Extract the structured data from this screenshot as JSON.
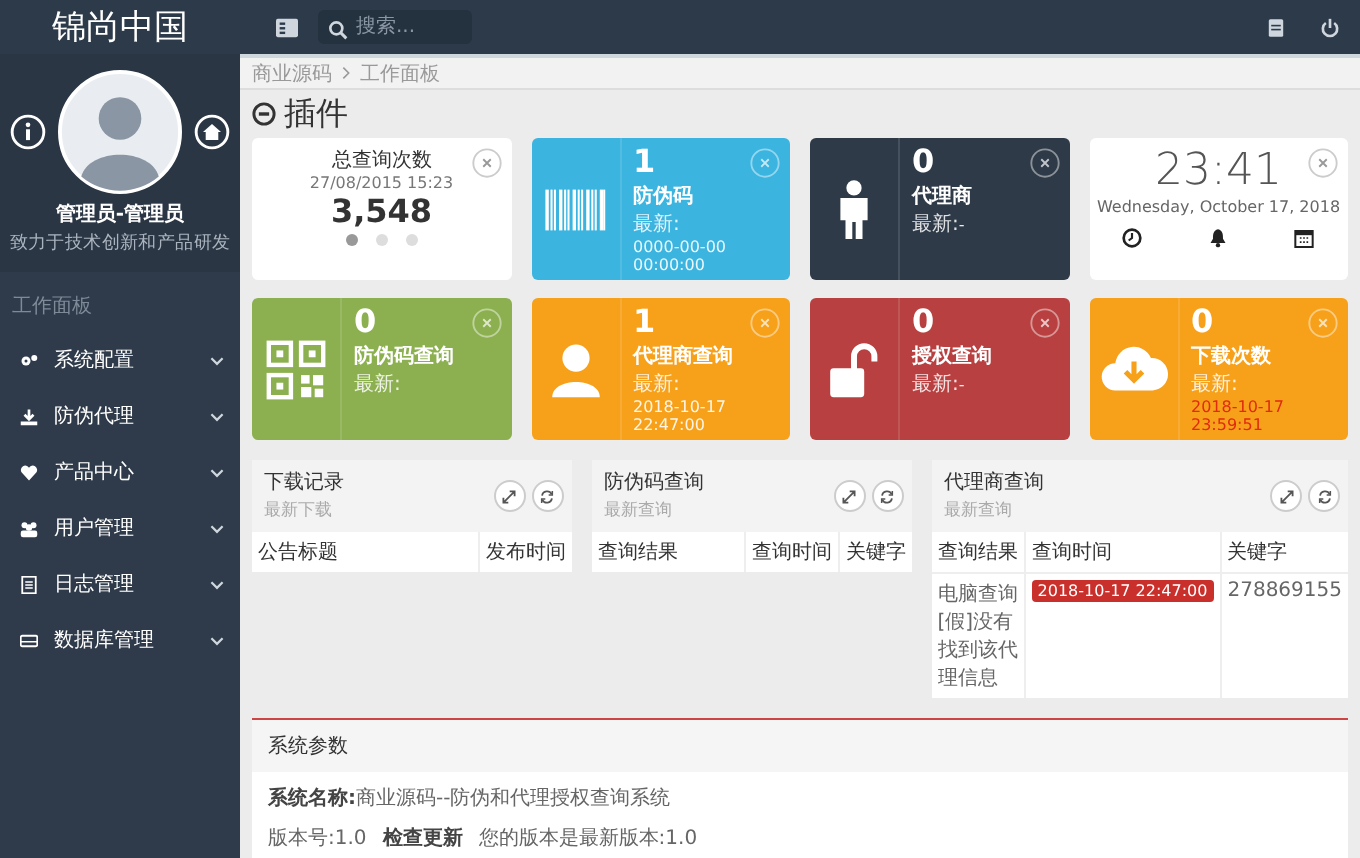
{
  "topbar": {
    "logo": "锦尚中国",
    "search": {
      "placeholder": "搜索..."
    }
  },
  "sidebar": {
    "user": {
      "name": "管理员-管理员",
      "motto": "致力于技术创新和产品研发"
    },
    "section": "工作面板",
    "items": [
      {
        "label": "系统配置",
        "expanded": false
      },
      {
        "label": "防伪代理",
        "expanded": false
      },
      {
        "label": "产品中心",
        "expanded": false
      },
      {
        "label": "用户管理",
        "expanded": false
      },
      {
        "label": "日志管理",
        "expanded": false
      },
      {
        "label": "数据库管理",
        "expanded": false
      }
    ]
  },
  "breadcrumb": [
    "商业源码",
    "工作面板"
  ],
  "page_title": "插件",
  "cards": [
    {
      "kind": "counter",
      "title": "总查询次数",
      "date": "27/08/2015 15:23",
      "value": "3,548",
      "dots": [
        {
          "selected": true
        },
        {
          "selected": false
        },
        {
          "selected": false
        }
      ]
    },
    {
      "kind": "stat",
      "color": "#3bb4e0",
      "value": "1",
      "label": "防伪码",
      "latest_label": "最新:",
      "latest_value": "0000-00-00 00:00:00"
    },
    {
      "kind": "stat",
      "color": "#2e3a48",
      "value": "0",
      "label": "代理商",
      "latest_label": "最新:",
      "latest_value": "-"
    },
    {
      "kind": "clock",
      "time": "23:41",
      "date": "Wednesday, October 17, 2018"
    },
    {
      "kind": "stat",
      "color": "#8cb04f",
      "value": "0",
      "label": "防伪码查询",
      "latest_label": "最新:"
    },
    {
      "kind": "stat",
      "color": "#f7a11b",
      "value": "1",
      "label": "代理商查询",
      "latest_label": "最新:",
      "latest_value": "2018-10-17 22:47:00"
    },
    {
      "kind": "stat",
      "color": "#b84040",
      "value": "0",
      "label": "授权查询",
      "latest_label": "最新:",
      "latest_value": "-"
    },
    {
      "kind": "stat",
      "color": "#f7a11b",
      "value": "0",
      "label": "下载次数",
      "latest_label": "最新:",
      "latest_value": "2018-10-17 23:59:51",
      "alert": true
    }
  ],
  "panels": [
    {
      "title": "下载记录",
      "subtitle": "最新下载",
      "columns": [
        "公告标题",
        "发布时间"
      ]
    },
    {
      "title": "防伪码查询",
      "subtitle": "最新查询",
      "columns": [
        "查询结果",
        "查询时间",
        "关键字"
      ]
    },
    {
      "title": "代理商查询",
      "subtitle": "最新查询",
      "columns": [
        "查询结果",
        "查询时间",
        "关键字"
      ],
      "rows": [
        [
          {
            "kind": "text",
            "text": "电脑查询[假]没有找到该代理信息"
          },
          {
            "kind": "badge",
            "text": "2018-10-17 22:47:00"
          },
          {
            "kind": "text",
            "text": "278869155"
          }
        ]
      ]
    }
  ],
  "system": {
    "title": "系统参数",
    "name_label": "系统名称:",
    "name_value": "商业源码--防伪和代理授权查询系统",
    "version": "版本号:1.0",
    "update_link": "检查更新",
    "update_status": "您的版本是最新版本:1.0"
  }
}
